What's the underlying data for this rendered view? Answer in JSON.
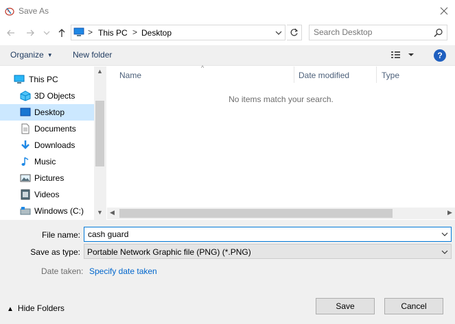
{
  "window": {
    "title": "Save As",
    "close_glyph": "✕"
  },
  "nav": {
    "back_glyph": "←",
    "forward_glyph": "→",
    "recent_glyph": "⌄",
    "up_glyph": "↑",
    "breadcrumb": [
      "This PC",
      "Desktop"
    ],
    "separator": ">",
    "search_placeholder": "Search Desktop"
  },
  "toolbar": {
    "organize": "Organize",
    "new_folder": "New folder",
    "help": "?"
  },
  "sidebar": {
    "items": [
      {
        "label": "This PC",
        "icon": "computer-icon"
      },
      {
        "label": "3D Objects",
        "icon": "cube-icon"
      },
      {
        "label": "Desktop",
        "icon": "desktop-icon",
        "selected": true
      },
      {
        "label": "Documents",
        "icon": "documents-icon"
      },
      {
        "label": "Downloads",
        "icon": "download-icon"
      },
      {
        "label": "Music",
        "icon": "music-icon"
      },
      {
        "label": "Pictures",
        "icon": "pictures-icon"
      },
      {
        "label": "Videos",
        "icon": "video-icon"
      },
      {
        "label": "Windows (C:)",
        "icon": "drive-icon"
      }
    ]
  },
  "filelist": {
    "columns": [
      "Name",
      "Date modified",
      "Type"
    ],
    "empty_message": "No items match your search."
  },
  "form": {
    "file_name_label": "File name:",
    "file_name_value": "cash guard",
    "save_type_label": "Save as type:",
    "save_type_value": "Portable Network Graphic file (PNG) (*.PNG)",
    "date_taken_label": "Date taken:",
    "date_taken_link": "Specify date taken"
  },
  "footer": {
    "hide_folders": "Hide Folders",
    "save": "Save",
    "cancel": "Cancel"
  },
  "colors": {
    "selected_bg": "#cce8ff",
    "link": "#0066cc",
    "accent": "#0078d7"
  }
}
